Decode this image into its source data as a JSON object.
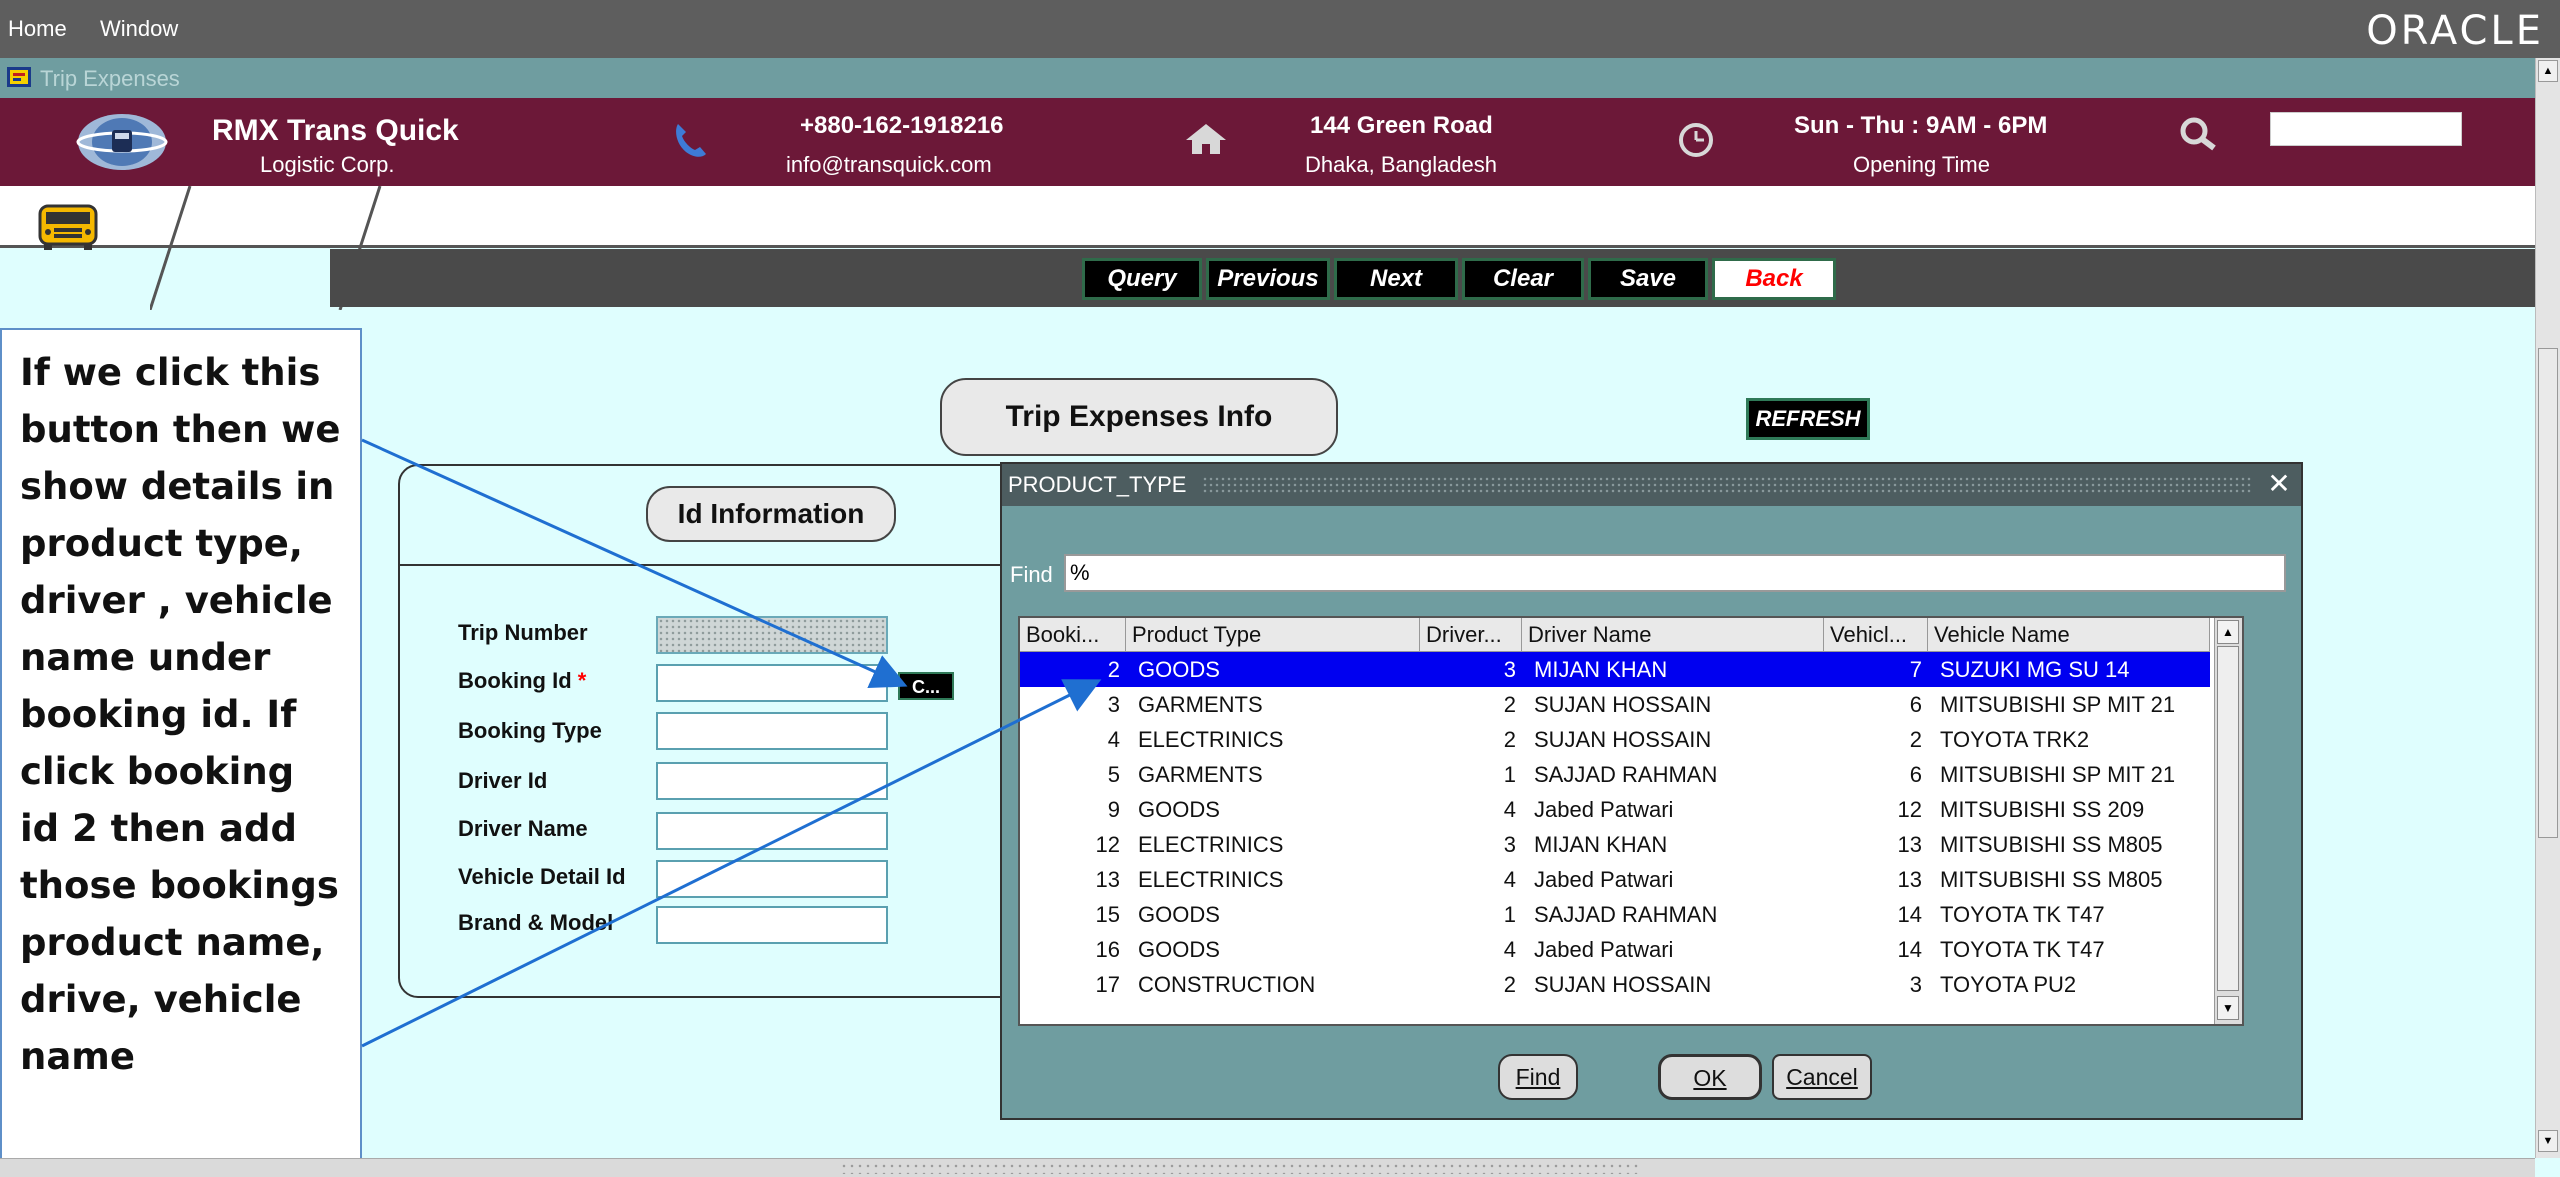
{
  "menubar": {
    "home": "Home",
    "window": "Window",
    "brand": "ORACLE"
  },
  "window": {
    "title": "Trip Expenses"
  },
  "header": {
    "company_name": "RMX Trans Quick",
    "company_sub": "Logistic Corp.",
    "phone": "+880-162-1918216",
    "email": "info@transquick.com",
    "address1": "144 Green Road",
    "address2": "Dhaka, Bangladesh",
    "hours": "Sun - Thu : 9AM - 6PM",
    "hours_label": "Opening Time",
    "search_value": ""
  },
  "toolbar": {
    "query": "Query",
    "previous": "Previous",
    "next": "Next",
    "clear": "Clear",
    "save": "Save",
    "back": "Back",
    "back_color": "#ff0000"
  },
  "form": {
    "heading": "Trip Expenses Info",
    "refresh": "REFRESH",
    "section": "Id Information",
    "labels": {
      "trip_number": "Trip Number",
      "booking_id": "Booking Id",
      "required_mark": "*",
      "booking_type": "Booking Type",
      "driver_id": "Driver Id",
      "driver_name": "Driver Name",
      "vehicle_detail_id": "Vehicle Detail Id",
      "brand_model": "Brand & Model"
    },
    "lov_button": "C..."
  },
  "annotation": {
    "text": "If we click this button then we show details in product type, driver , vehicle name under booking id. If click booking id 2 then add those bookings product name, drive, vehicle name"
  },
  "dialog": {
    "title": "PRODUCT_TYPE",
    "find_label": "Find",
    "find_value": "%",
    "columns": [
      "Booki...",
      "Product Type",
      "Driver...",
      "Driver Name",
      "Vehicl...",
      "Vehicle Name"
    ],
    "rows": [
      {
        "booking": "2",
        "product": "GOODS",
        "driver_id": "3",
        "driver": "MIJAN KHAN",
        "vehicle_id": "7",
        "vehicle": "SUZUKI MG SU 14",
        "selected": true
      },
      {
        "booking": "3",
        "product": "GARMENTS",
        "driver_id": "2",
        "driver": "SUJAN HOSSAIN",
        "vehicle_id": "6",
        "vehicle": "MITSUBISHI SP MIT 21"
      },
      {
        "booking": "4",
        "product": "ELECTRINICS",
        "driver_id": "2",
        "driver": "SUJAN HOSSAIN",
        "vehicle_id": "2",
        "vehicle": "TOYOTA TRK2"
      },
      {
        "booking": "5",
        "product": "GARMENTS",
        "driver_id": "1",
        "driver": "SAJJAD RAHMAN",
        "vehicle_id": "6",
        "vehicle": "MITSUBISHI SP MIT 21"
      },
      {
        "booking": "9",
        "product": "GOODS",
        "driver_id": "4",
        "driver": "Jabed Patwari",
        "vehicle_id": "12",
        "vehicle": "MITSUBISHI SS 209"
      },
      {
        "booking": "12",
        "product": "ELECTRINICS",
        "driver_id": "3",
        "driver": "MIJAN KHAN",
        "vehicle_id": "13",
        "vehicle": "MITSUBISHI SS M805"
      },
      {
        "booking": "13",
        "product": "ELECTRINICS",
        "driver_id": "4",
        "driver": "Jabed Patwari",
        "vehicle_id": "13",
        "vehicle": "MITSUBISHI SS M805"
      },
      {
        "booking": "15",
        "product": "GOODS",
        "driver_id": "1",
        "driver": "SAJJAD RAHMAN",
        "vehicle_id": "14",
        "vehicle": "TOYOTA TK T47"
      },
      {
        "booking": "16",
        "product": "GOODS",
        "driver_id": "4",
        "driver": "Jabed Patwari",
        "vehicle_id": "14",
        "vehicle": "TOYOTA TK T47"
      },
      {
        "booking": "17",
        "product": "CONSTRUCTION",
        "driver_id": "2",
        "driver": "SUJAN HOSSAIN",
        "vehicle_id": "3",
        "vehicle": "TOYOTA PU2"
      }
    ],
    "buttons": {
      "find": "Find",
      "ok": "OK",
      "cancel": "Cancel"
    }
  }
}
